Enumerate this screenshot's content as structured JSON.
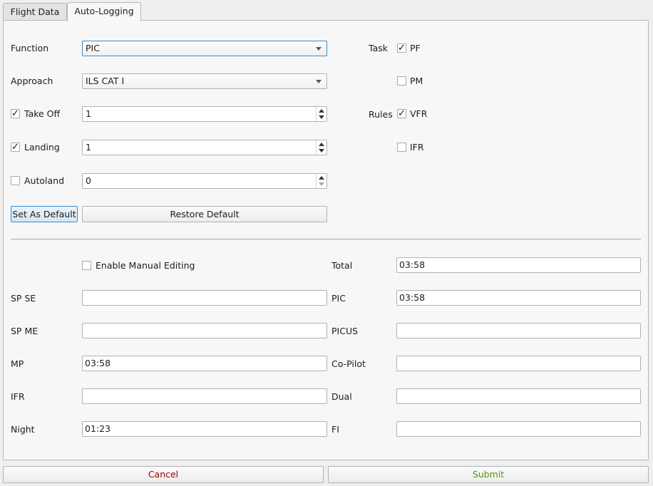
{
  "tabs": [
    {
      "label": "Flight Data"
    },
    {
      "label": "Auto-Logging"
    }
  ],
  "logging": {
    "function": {
      "label": "Function",
      "value": "PIC"
    },
    "approach": {
      "label": "Approach",
      "value": "ILS CAT I"
    },
    "take_off": {
      "label": "Take Off",
      "checked": true,
      "value": "1"
    },
    "landing": {
      "label": "Landing",
      "checked": true,
      "value": "1"
    },
    "autoland": {
      "label": "Autoland",
      "checked": false,
      "value": "0"
    },
    "set_default_label": "Set As Default",
    "restore_default_label": "Restore Default",
    "task": {
      "label": "Task",
      "pf": {
        "label": "PF",
        "checked": true
      },
      "pm": {
        "label": "PM",
        "checked": false
      }
    },
    "rules": {
      "label": "Rules",
      "vfr": {
        "label": "VFR",
        "checked": true
      },
      "ifr": {
        "label": "IFR",
        "checked": false
      }
    }
  },
  "times": {
    "manual_editing": {
      "label": "Enable Manual Editing",
      "checked": false
    },
    "left": [
      {
        "label": "SP SE",
        "value": ""
      },
      {
        "label": "SP ME",
        "value": ""
      },
      {
        "label": "MP",
        "value": "03:58"
      },
      {
        "label": "IFR",
        "value": ""
      },
      {
        "label": "Night",
        "value": "01:23"
      }
    ],
    "right": [
      {
        "label": "Total",
        "value": "03:58"
      },
      {
        "label": "PIC",
        "value": "03:58"
      },
      {
        "label": "PICUS",
        "value": ""
      },
      {
        "label": "Co-Pilot",
        "value": ""
      },
      {
        "label": "Dual",
        "value": ""
      },
      {
        "label": "FI",
        "value": ""
      }
    ]
  },
  "actions": {
    "cancel": {
      "label": "Cancel",
      "color": "#a40000"
    },
    "submit": {
      "label": "Submit",
      "color": "#4e9a06"
    }
  },
  "colors": {
    "focus": "#3d8bc7",
    "background": "#efefef"
  }
}
